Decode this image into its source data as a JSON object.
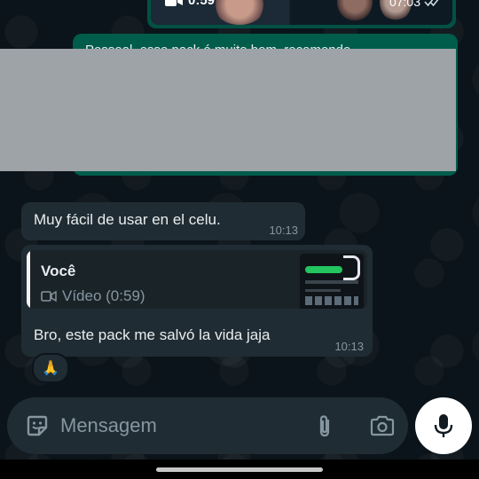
{
  "video_message": {
    "duration": "0:59",
    "time": "07:03"
  },
  "outgoing_partial": {
    "line1": "Pessoal, esse pack é muito bom, recomendo",
    "line2": "..."
  },
  "messages": [
    {
      "text": "Muy fácil de usar en el celu.",
      "time": "10:13"
    },
    {
      "quote_author": "Você",
      "quote_media": "Vídeo (0:59)",
      "text": "Bro, este pack me salvó la vida jaja",
      "time": "10:13",
      "reaction": "🙏"
    }
  ],
  "composer": {
    "placeholder": "Mensagem"
  },
  "colors": {
    "outgoing": "#005c4b",
    "incoming": "#202c33",
    "background": "#0b141a",
    "muted": "#8696a0"
  }
}
